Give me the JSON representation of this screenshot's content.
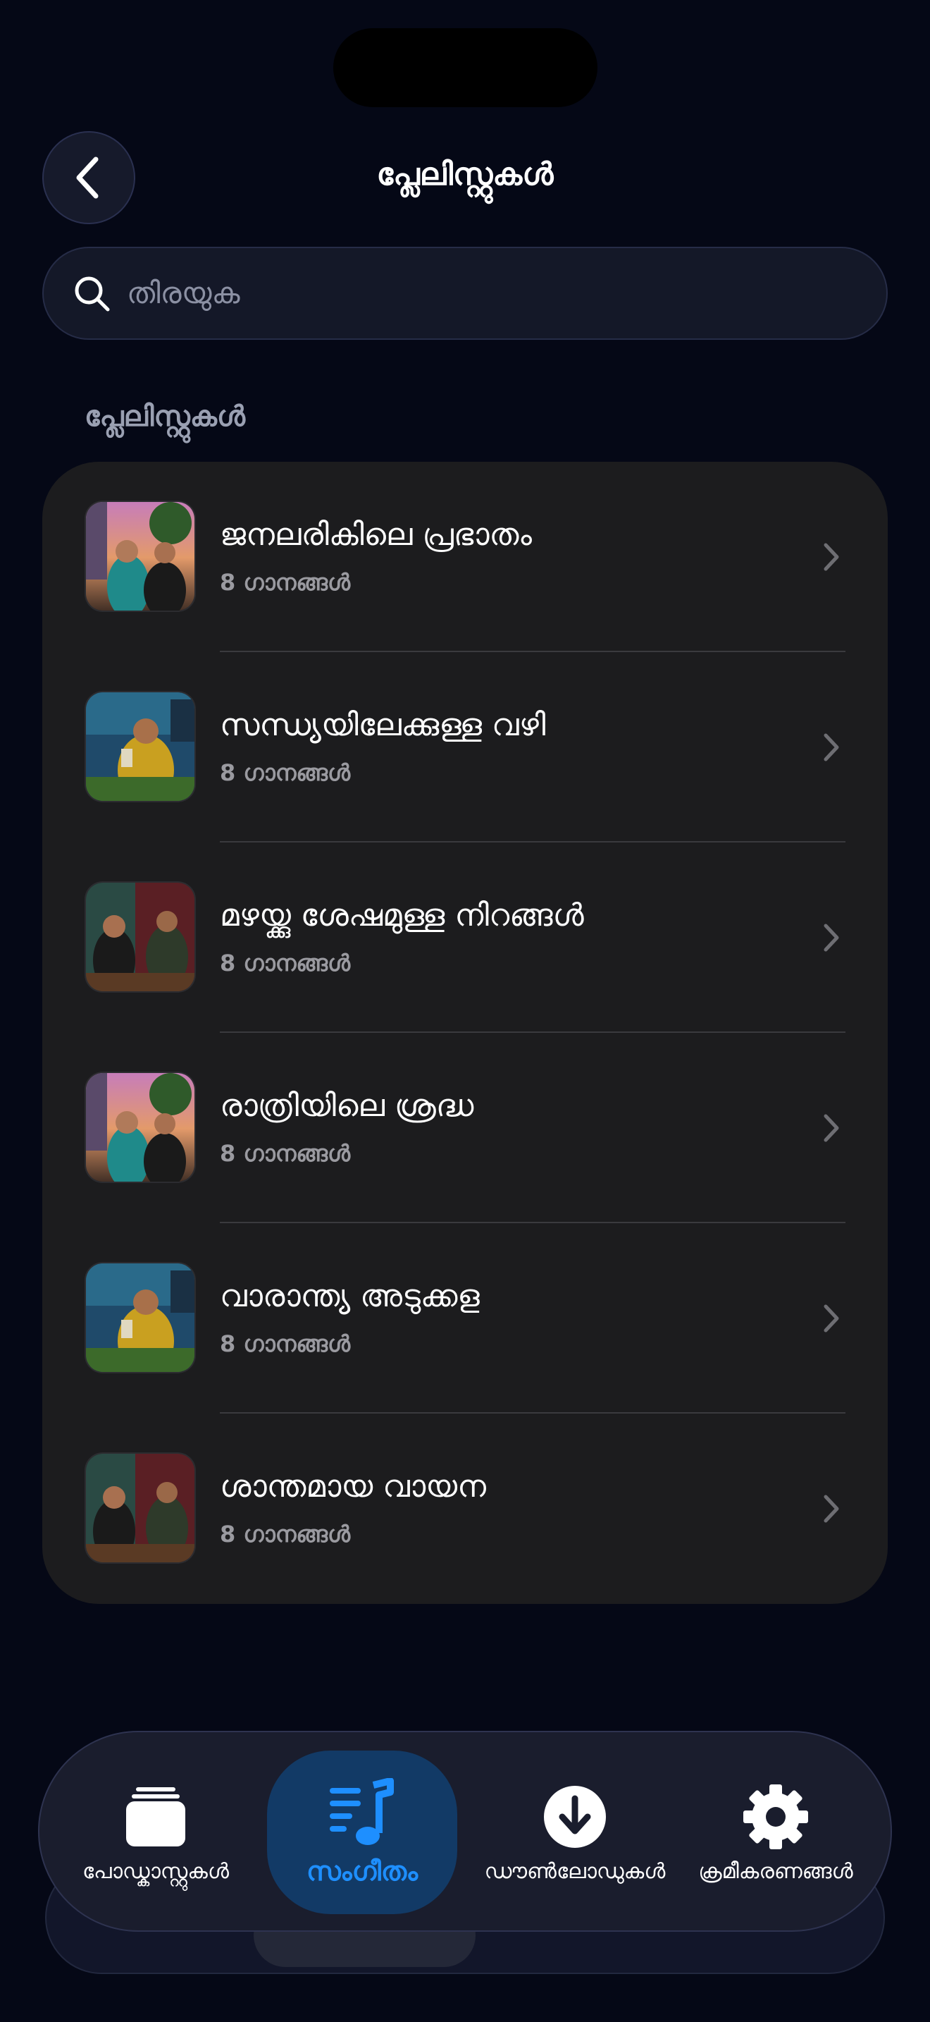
{
  "header": {
    "title": "പ്ലേലിസ്റ്റുകൾ"
  },
  "search": {
    "placeholder": "തിരയുക"
  },
  "section": {
    "label": "പ്ലേലിസ്റ്റുകൾ"
  },
  "playlists": [
    {
      "title": "ജനലരികിലെ പ്രഭാതം",
      "count": "8 ഗാനങ്ങൾ"
    },
    {
      "title": "സന്ധ്യയിലേക്കുള്ള വഴി",
      "count": "8 ഗാനങ്ങൾ"
    },
    {
      "title": "മഴയ്ക്കു ശേഷമുള്ള നിറങ്ങൾ",
      "count": "8 ഗാനങ്ങൾ"
    },
    {
      "title": "രാത്രിയിലെ ശ്രദ്ധ",
      "count": "8 ഗാനങ്ങൾ"
    },
    {
      "title": "വാരാന്ത്യ അടുക്കള",
      "count": "8 ഗാനങ്ങൾ"
    },
    {
      "title": "ശാന്തമായ വായന",
      "count": "8 ഗാനങ്ങൾ"
    }
  ],
  "tabbar": {
    "tabs": [
      {
        "label": "പോഡ്കാസ്റ്റുകൾ",
        "icon": "stack-icon",
        "active": false
      },
      {
        "label": "സംഗീതം",
        "icon": "music-note-icon",
        "active": true
      },
      {
        "label": "ഡൗൺലോഡുകൾ",
        "icon": "download-icon",
        "active": false
      },
      {
        "label": "ക്രമീകരണങ്ങൾ",
        "icon": "gear-icon",
        "active": false
      }
    ]
  },
  "colors": {
    "background": "#050816",
    "card": "#1c1c1e",
    "accent": "#1e8fff"
  }
}
